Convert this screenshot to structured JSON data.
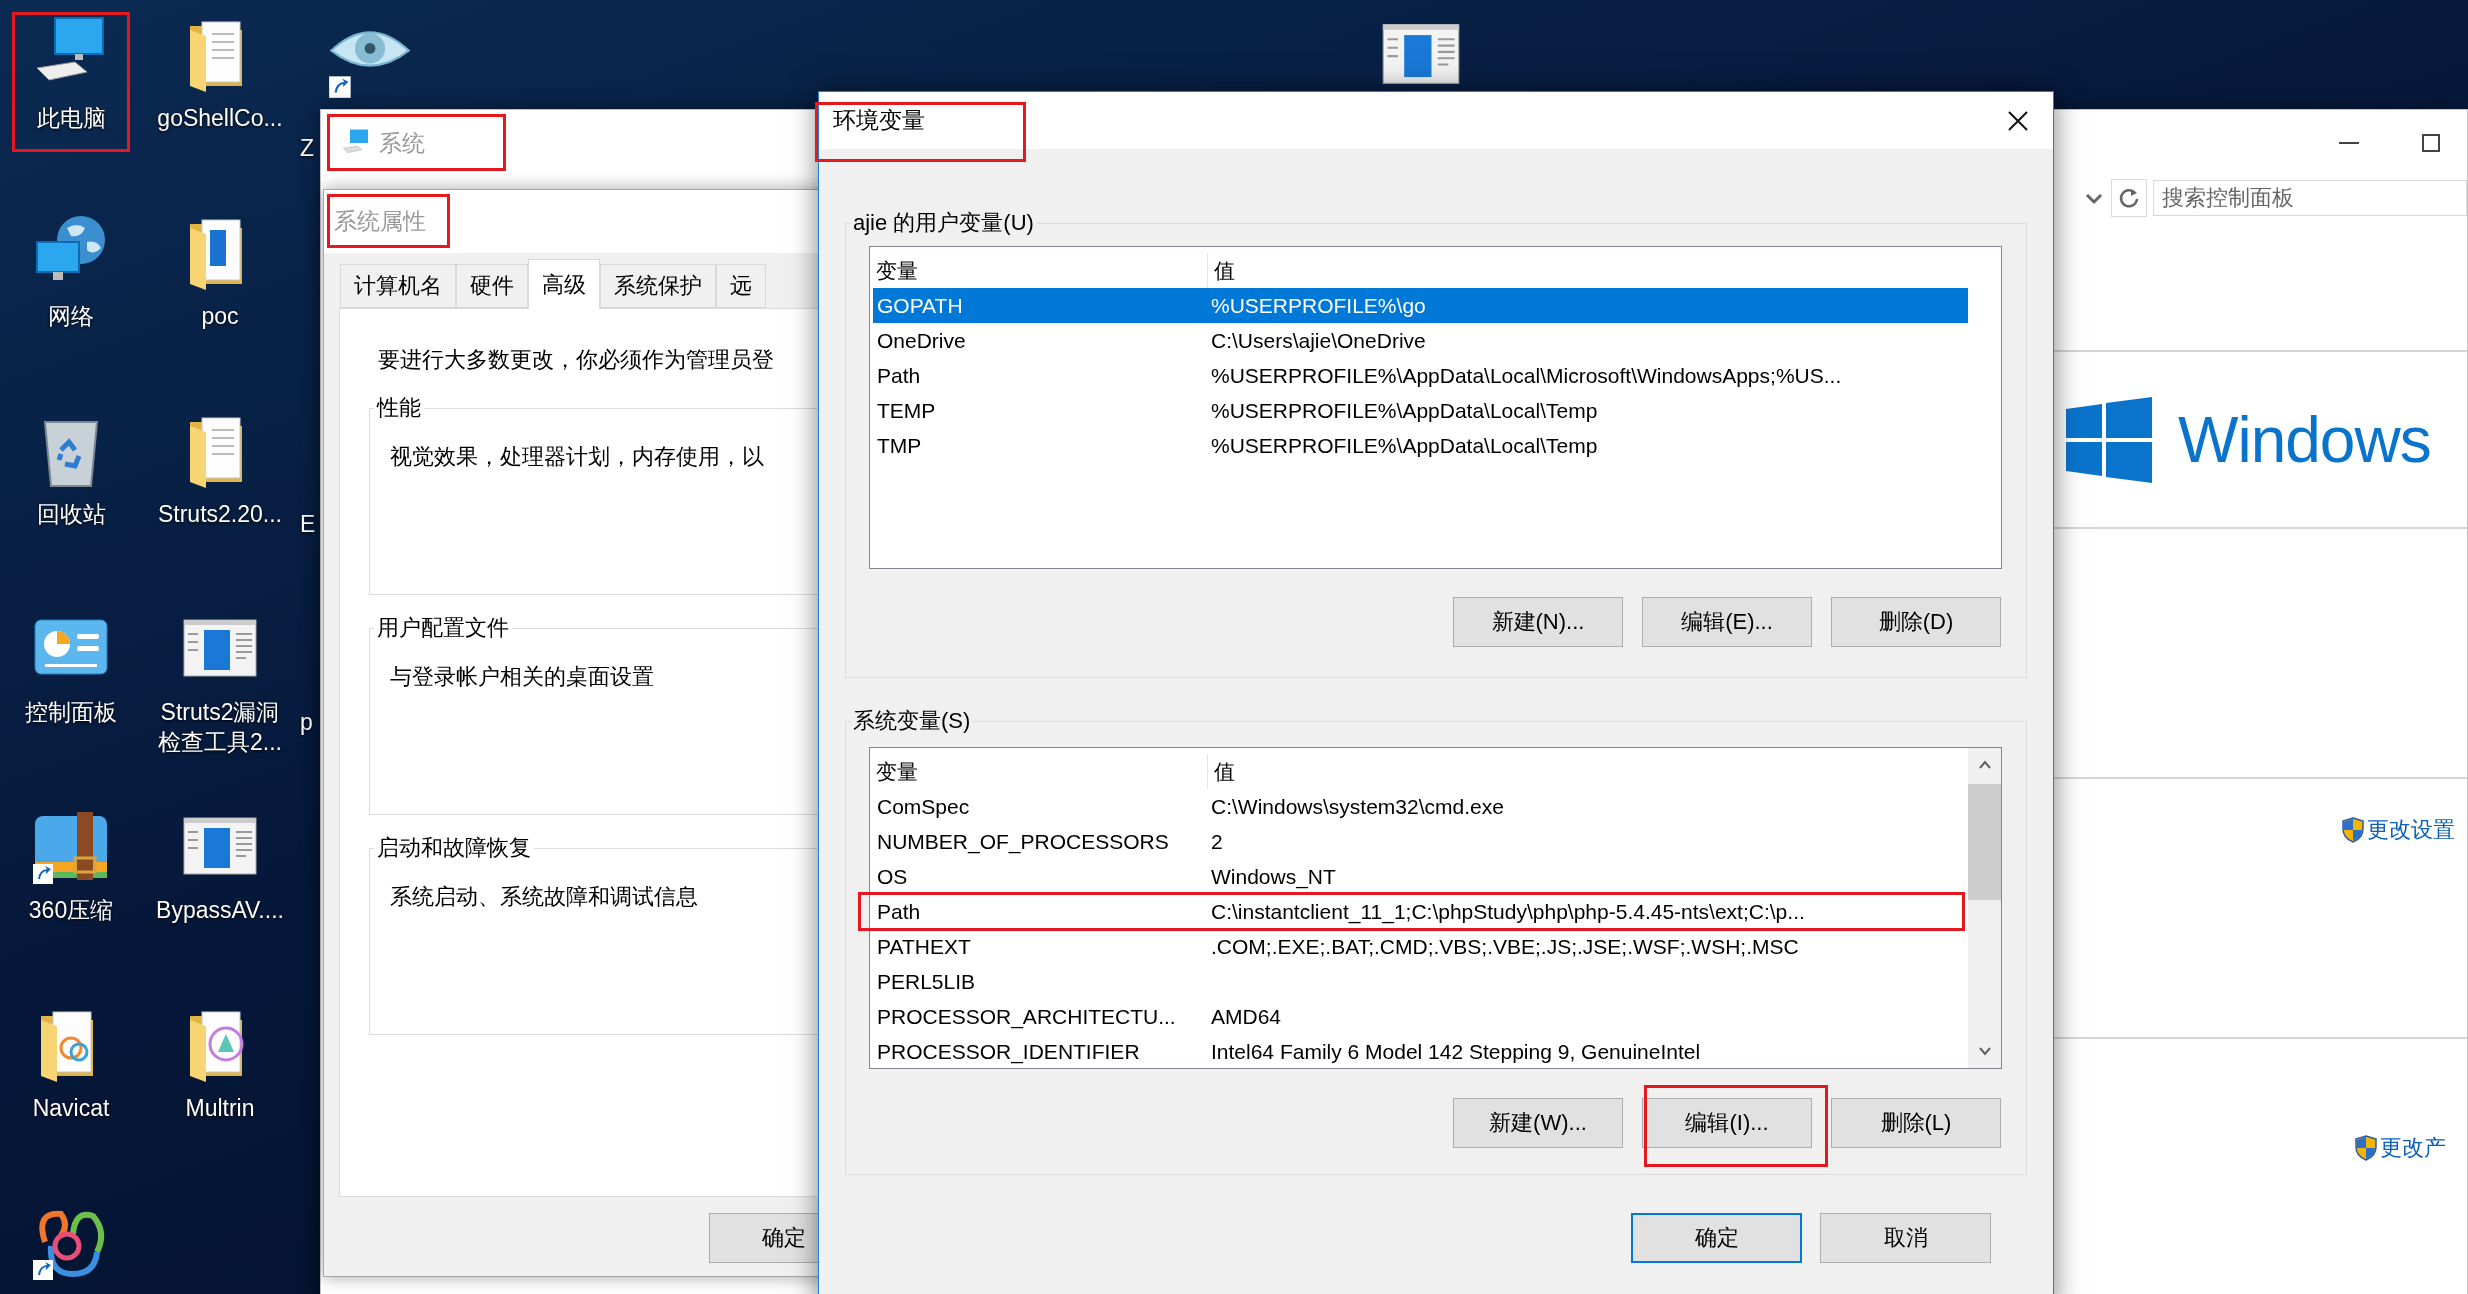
{
  "desktop": {
    "columns": [
      [
        {
          "label": "此电脑",
          "kind": "computer",
          "annotated": true
        },
        {
          "label": "网络",
          "kind": "network",
          "annotated": false
        },
        {
          "label": "回收站",
          "kind": "recycle",
          "annotated": false
        },
        {
          "label": "控制面板",
          "kind": "control",
          "annotated": false
        },
        {
          "label": "360压缩",
          "kind": "zip",
          "shortcut": true,
          "annotated": false
        },
        {
          "label": "Navicat",
          "kind": "navicat-folder",
          "annotated": false
        },
        {
          "kind": "navicat",
          "shortcut": true,
          "annotated": false
        }
      ],
      [
        {
          "label": "goShellCo...",
          "kind": "folder",
          "annotated": false
        },
        {
          "label": "poc",
          "kind": "folder-doc",
          "annotated": false
        },
        {
          "label": "Struts2.20...",
          "kind": "folder",
          "annotated": false
        },
        {
          "lines": [
            "Struts2漏洞",
            "检查工具2..."
          ],
          "kind": "app",
          "annotated": false
        },
        {
          "label": "BypassAV....",
          "kind": "app",
          "annotated": false
        },
        {
          "label": "Multrin",
          "kind": "multrin-folder",
          "annotated": false
        }
      ],
      [
        {
          "label": "Z",
          "kind": "eye",
          "shortcut": true,
          "annotated": false
        },
        {
          "label": "E",
          "annotated": false
        },
        {
          "label": "p",
          "annotated": false
        }
      ]
    ],
    "extra_icons": [
      {
        "kind": "app"
      }
    ]
  },
  "system_window": {
    "title": "系统",
    "title_annotated": true,
    "search": {
      "placeholder": "搜索控制面板"
    },
    "brand": "Windows",
    "links": [
      "更改设置",
      "更改产"
    ]
  },
  "system_properties": {
    "title": "系统属性",
    "title_annotated": true,
    "tabs": [
      {
        "label": "计算机名",
        "selected": false
      },
      {
        "label": "硬件",
        "selected": false
      },
      {
        "label": "高级",
        "selected": true
      },
      {
        "label": "系统保护",
        "selected": false
      },
      {
        "label": "远",
        "selected": false
      }
    ],
    "notice": "要进行大多数更改，你必须作为管理员登",
    "groups": [
      {
        "title": "性能",
        "text": "视觉效果，处理器计划，内存使用，以"
      },
      {
        "title": "用户配置文件",
        "text": "与登录帐户相关的桌面设置"
      },
      {
        "title": "启动和故障恢复",
        "text": "系统启动、系统故障和调试信息"
      }
    ],
    "buttons": [
      "确定"
    ]
  },
  "env_dialog": {
    "title": "环境变量",
    "title_annotated": true,
    "user_vars": {
      "title": "ajie 的用户变量(U)",
      "columns": [
        "变量",
        "值"
      ],
      "rows": [
        {
          "name": "GOPATH",
          "value": "%USERPROFILE%\\go",
          "selected": true,
          "annotated": false
        },
        {
          "name": "OneDrive",
          "value": "C:\\Users\\ajie\\OneDrive",
          "selected": false,
          "annotated": false
        },
        {
          "name": "Path",
          "value": "%USERPROFILE%\\AppData\\Local\\Microsoft\\WindowsApps;%US...",
          "selected": false,
          "annotated": false
        },
        {
          "name": "TEMP",
          "value": "%USERPROFILE%\\AppData\\Local\\Temp",
          "selected": false,
          "annotated": false
        },
        {
          "name": "TMP",
          "value": "%USERPROFILE%\\AppData\\Local\\Temp",
          "selected": false,
          "annotated": false
        }
      ],
      "buttons": [
        {
          "label": "新建(N)...",
          "annotated": false
        },
        {
          "label": "编辑(E)...",
          "annotated": false
        },
        {
          "label": "删除(D)",
          "annotated": false
        }
      ]
    },
    "system_vars": {
      "title": "系统变量(S)",
      "columns": [
        "变量",
        "值"
      ],
      "rows": [
        {
          "name": "ComSpec",
          "value": "C:\\Windows\\system32\\cmd.exe",
          "selected": false,
          "annotated": false
        },
        {
          "name": "NUMBER_OF_PROCESSORS",
          "value": "2",
          "selected": false,
          "annotated": false
        },
        {
          "name": "OS",
          "value": "Windows_NT",
          "selected": false,
          "annotated": false
        },
        {
          "name": "Path",
          "value": "C:\\instantclient_11_1;C:\\phpStudy\\php\\php-5.4.45-nts\\ext;C:\\p...",
          "selected": false,
          "annotated": true
        },
        {
          "name": "PATHEXT",
          "value": ".COM;.EXE;.BAT;.CMD;.VBS;.VBE;.JS;.JSE;.WSF;.WSH;.MSC",
          "selected": false,
          "annotated": false
        },
        {
          "name": "PERL5LIB",
          "selected": false,
          "annotated": false
        },
        {
          "name": "PROCESSOR_ARCHITECTU...",
          "value": "AMD64",
          "selected": false,
          "annotated": false
        },
        {
          "name": "PROCESSOR_IDENTIFIER",
          "value": "Intel64 Family 6 Model 142 Stepping 9, GenuineIntel",
          "selected": false,
          "annotated": false
        }
      ],
      "buttons": [
        {
          "label": "新建(W)...",
          "annotated": false
        },
        {
          "label": "编辑(I)...",
          "annotated": true
        },
        {
          "label": "删除(L)",
          "annotated": false
        }
      ]
    },
    "buttons": [
      {
        "label": "确定",
        "default": true
      },
      {
        "label": "取消",
        "default": false
      }
    ]
  }
}
